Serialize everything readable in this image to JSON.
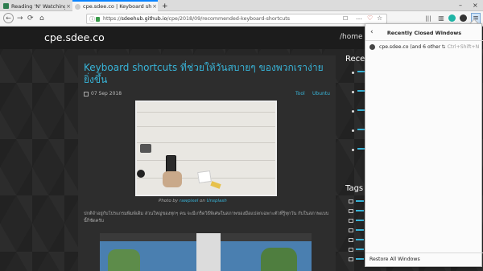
{
  "tabs": [
    {
      "title": "Reading 'N' Watching | S",
      "close": "×"
    },
    {
      "title": "cpe.sdee.co | Keyboard shor",
      "close": "×"
    },
    {
      "title": "+",
      "close": ""
    }
  ],
  "window": {
    "minimize": "–",
    "close": "×"
  },
  "navbar": {
    "back": "←",
    "forward": "→",
    "reload": "⟳",
    "home": "⌂",
    "url_scheme": "https://",
    "url_host": "sdeehub.github.io",
    "url_path": "/cpe/2018/09/recommended-keyboard-shortcuts",
    "lock": "🔒",
    "info": "ⓘ",
    "reader": "☐",
    "more": "…",
    "pocket": "♡",
    "star": "☆",
    "library": "|||",
    "sidebar": "▥",
    "menu": "≡"
  },
  "site": {
    "title": "cpe.sdee.co",
    "nav_home": "/home"
  },
  "post": {
    "title": "Keyboard shortcuts ที่ช่วยให้วันสบายๆ ของพวกเราง่ายยิ่งขึ้น",
    "date": "07 Sep 2018",
    "tags": [
      "Tool",
      "Ubuntu"
    ],
    "caption_prefix": "Photo by",
    "caption_author": "rawpixel",
    "caption_mid": "on",
    "caption_site": "Unsplash",
    "body": "ปกติจำอยู่กับโปรแกรมพิมพ์เดิม ส่วนใหญ่ของทุกๆ คน จะมีเกร็ดวิธีพิเศษในสภาพของมือแปลกเฉพาะตัวที่รู้ทุกวัน กับในสภาพแบบนี้ก็ชัดครับ"
  },
  "sidebar": {
    "recent_heading": "Rece",
    "tags_heading": "Tags"
  },
  "panel": {
    "back": "‹",
    "title": "Recently Closed Windows",
    "item_name": "cpe.sdee.co (and 6 other ta...",
    "item_shortcut": "Ctrl+Shift+N",
    "restore": "Restore All Windows"
  }
}
